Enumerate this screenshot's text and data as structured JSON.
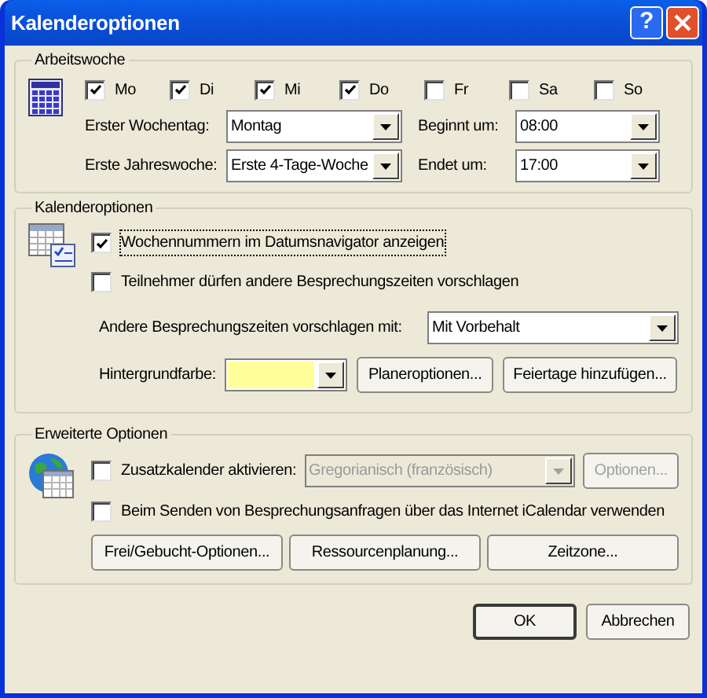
{
  "window": {
    "title": "Kalenderoptionen",
    "help": "?"
  },
  "arbeitswoche": {
    "title": "Arbeitswoche",
    "days": [
      {
        "label": "Mo",
        "checked": true
      },
      {
        "label": "Di",
        "checked": true
      },
      {
        "label": "Mi",
        "checked": true
      },
      {
        "label": "Do",
        "checked": true
      },
      {
        "label": "Fr",
        "checked": false
      },
      {
        "label": "Sa",
        "checked": false
      },
      {
        "label": "So",
        "checked": false
      }
    ],
    "fields": [
      {
        "label": "Erster Wochentag:",
        "value": "Montag"
      },
      {
        "label": "Beginnt um:",
        "value": "08:00"
      },
      {
        "label": "Erste Jahreswoche:",
        "value": "Erste 4-Tage-Woche"
      },
      {
        "label": "Endet um:",
        "value": "17:00"
      }
    ]
  },
  "kalenderoptionen": {
    "title": "Kalenderoptionen",
    "checks": [
      {
        "label": "Wochennummern im Datumsnavigator anzeigen",
        "checked": true,
        "focused": true
      },
      {
        "label": "Teilnehmer dürfen andere Besprechungszeiten vorschlagen",
        "checked": false,
        "focused": false
      }
    ],
    "propose": {
      "label": "Andere Besprechungszeiten vorschlagen mit:",
      "value": "Mit Vorbehalt"
    },
    "background": {
      "label": "Hintergrundfarbe:",
      "color": "#ffff99"
    },
    "buttons": [
      "Planeroptionen...",
      "Feiertage hinzufügen..."
    ]
  },
  "erweitert": {
    "title": "Erweiterte Optionen",
    "extra_calendar": {
      "label": "Zusatzkalender aktivieren:",
      "checked": false,
      "value": "Gregorianisch (französisch)",
      "disabled": true,
      "button": "Optionen..."
    },
    "icalendar": {
      "label": "Beim Senden von Besprechungsanfragen über das Internet iCalendar verwenden",
      "checked": false
    },
    "buttons": [
      "Frei/Gebucht-Optionen...",
      "Ressourcenplanung...",
      "Zeitzone..."
    ]
  },
  "footer": {
    "buttons": [
      "OK",
      "Abbrechen"
    ]
  }
}
